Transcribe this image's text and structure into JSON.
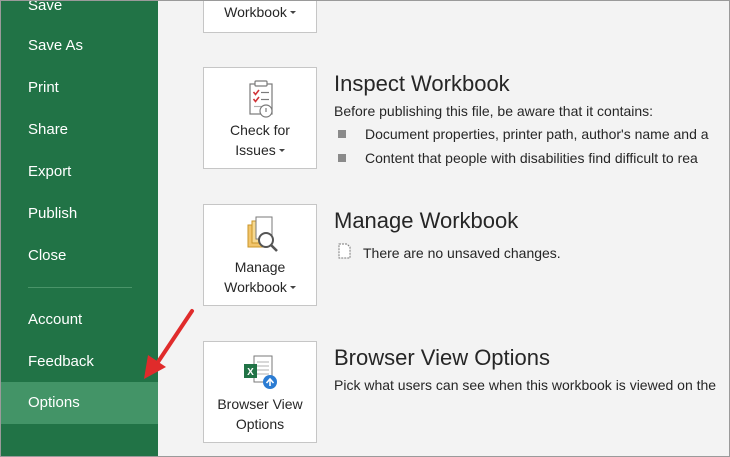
{
  "sidebar": {
    "items": [
      {
        "label": "Save"
      },
      {
        "label": "Save As"
      },
      {
        "label": "Print"
      },
      {
        "label": "Share"
      },
      {
        "label": "Export"
      },
      {
        "label": "Publish"
      },
      {
        "label": "Close"
      },
      {
        "label": "Account"
      },
      {
        "label": "Feedback"
      },
      {
        "label": "Options",
        "selected": true
      }
    ]
  },
  "main": {
    "top_tile": {
      "label": "Workbook"
    },
    "inspect": {
      "button_line1": "Check for",
      "button_line2": "Issues",
      "title": "Inspect Workbook",
      "description": "Before publishing this file, be aware that it contains:",
      "bullets": [
        "Document properties, printer path, author's name and a",
        "Content that people with disabilities find difficult to rea"
      ]
    },
    "manage": {
      "button_line1": "Manage",
      "button_line2": "Workbook",
      "title": "Manage Workbook",
      "status": "There are no unsaved changes."
    },
    "browser": {
      "button_line1": "Browser View",
      "button_line2": "Options",
      "title": "Browser View Options",
      "description": "Pick what users can see when this workbook is viewed on the"
    }
  },
  "colors": {
    "sidebar": "#217346",
    "sidebar_selected": "#439467",
    "arrow": "#e02b2b"
  }
}
